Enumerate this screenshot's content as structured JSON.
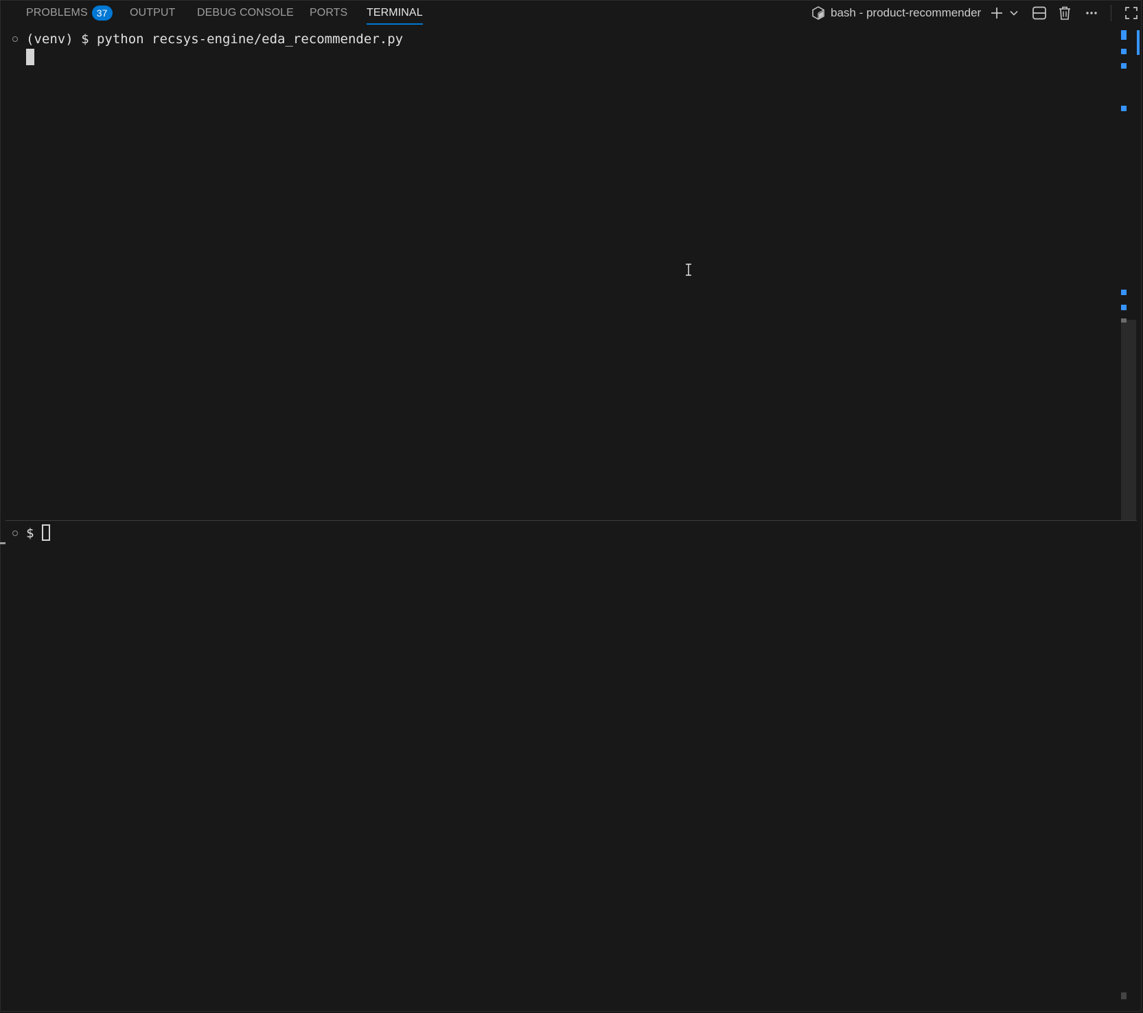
{
  "tabs": [
    {
      "label": "PROBLEMS",
      "badge": "37",
      "active": false
    },
    {
      "label": "OUTPUT",
      "active": false
    },
    {
      "label": "DEBUG CONSOLE",
      "active": false
    },
    {
      "label": "PORTS",
      "active": false
    },
    {
      "label": "TERMINAL",
      "active": true
    }
  ],
  "terminal": {
    "name": "bash - product-recommender",
    "icons": [
      "terminal-bash-icon",
      "add-icon",
      "chevron-down-icon",
      "split-icon",
      "trash-icon",
      "more-icon",
      "maximize-icon"
    ]
  },
  "pane_top": {
    "command_line": "(venv) $ python recsys-engine/eda_recommender.py"
  },
  "pane_bottom": {
    "prompt": "$"
  },
  "colors": {
    "background": "#181818",
    "accent": "#0078d4",
    "marker": "#3794ff",
    "text": "#cccccc"
  }
}
